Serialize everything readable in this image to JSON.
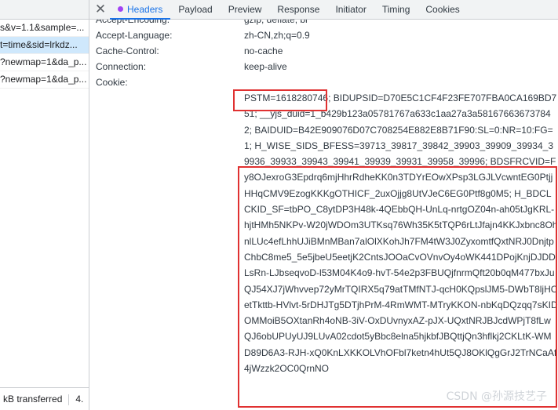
{
  "request_list": {
    "rows": [
      "s&v=1.1&sample=...",
      "t=time&sid=lrkdz...",
      "?newmap=1&da_p...",
      "?newmap=1&da_p..."
    ],
    "status_text": "kB transferred",
    "status_extra": "4."
  },
  "tabs": {
    "close_glyph": "✕",
    "items": [
      "Headers",
      "Payload",
      "Preview",
      "Response",
      "Initiator",
      "Timing",
      "Cookies"
    ],
    "active": "Headers",
    "active_dot_color": "#a142f4"
  },
  "headers": {
    "partial_row": {
      "name": "Accept-Encoding:",
      "value": "gzip, deflate, br"
    },
    "rows": [
      {
        "name": "Accept-Language:",
        "value": "zh-CN,zh;q=0.9"
      },
      {
        "name": "Cache-Control:",
        "value": "no-cache"
      },
      {
        "name": "Connection:",
        "value": "keep-alive"
      },
      {
        "name": "Cookie:",
        "value": ""
      }
    ],
    "cookie_value": "PSTM=1618280746; BIDUPSID=D70E5C1CF4F23FE707FBA0CA169BD751; __yjs_duid=1_b429b123a05781767a633c1aa27a3a581676636737842; BAIDUID=B42E909076D07C708254E882E8B71F90:SL=0:NR=10:FG=1; H_WISE_SIDS_BFESS=39713_39817_39842_39903_39909_39934_39936_39933_39943_39941_39939_39931_39958_39996; BDSFRCVID=Fy8OJexroG3Epdrq6mjHhrRdheKK0n3TDYrEOwXPsp3LGJLVcwntEG0PtjjHHqCMV9EzogKKKgOTHICF_2uxOjjg8UtVJeC6EG0Ptf8g0M5; H_BDCLCKID_SF=tbPO_C8ytDP3H48k-4QEbbQH-UnLq-nrtgOZ04n-ah05tJgKRL-hjtHMh5NKPv-W20jWDOm3UTKsq76Wh35K5tTQP6rLtJfajn4KKJxbnc8OhnlLUc4efLhhUJiBMnMBan7alOlXKohJh7FM4tW3J0ZyxomtfQxtNRJ0DnjtpChbC8me5_5e5jbeU5eetjK2CntsJOOaCvOVnvOy4oWK441DPojKnjDJDDLsRn-LJbseqvoD-l53M04K4o9-hvT-54e2p3FBUQjfnrmQft20b0qM477bxJuQJ54XJ7jWhvvep72yMrTQIRX5q79atTMfNTJ-qcH0KQpslJM5-DWbT8ljHCetTkttb-HVlvt-5rDHJTg5DTjhPrM-4RmWMT-MTryKKON-nbKqDQzqq7sKIDOMMoiB5OXtanRh4oNB-3iV-OxDUvnyxAZ-pJX-UQxtNRJBJcdWPjT8fLwQJ6obUPUyUJ9LUvA02cdot5yBbc8elna5hjkbfJBQttjQn3hflkj2CKLtK-WMD89D6A3-RJH-xQ0KnLXKKOLVhOFbl7ketn4hUt5QJ8OKlQgGrJ2TrNCaAf4jWzzk2OC0QrnNO",
    "watermark": "CSDN @孙源技艺子"
  }
}
